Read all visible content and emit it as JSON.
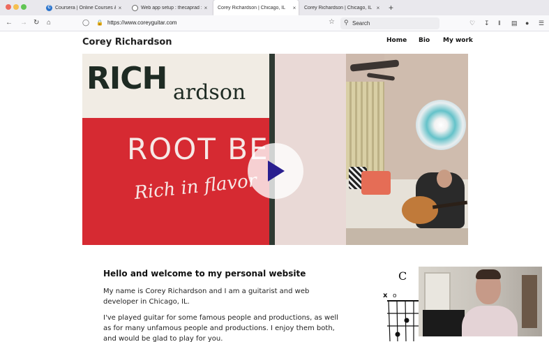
{
  "browser": {
    "tabs": [
      {
        "title": "Coursera | Online Courses & Cre",
        "icon": "coursera-favicon",
        "active": false
      },
      {
        "title": "Web app setup : thecaprad : Py",
        "icon": "reddit-favicon",
        "active": false
      },
      {
        "title": "Corey Richardson | Chicago, IL",
        "icon": "none",
        "active": true
      },
      {
        "title": "Corey Richardson | Chicago, IL",
        "icon": "none",
        "active": false
      }
    ],
    "close_glyph": "×",
    "new_tab_glyph": "+",
    "url": "https://www.coreyguitar.com",
    "search_placeholder": "Search",
    "colors": {
      "tabbar": "#e9e8ed",
      "navbar": "#f9f9fb",
      "accent_red": "#ed6a5e",
      "accent_yellow": "#f5bf4f",
      "accent_green": "#61c554"
    }
  },
  "site": {
    "title": "Corey Richardson",
    "nav": [
      "Home",
      "Bio",
      "My work"
    ],
    "hero": {
      "sign_text_1": "RICH",
      "sign_text_2": "ardson",
      "sign_text_3": "ROOT BEER",
      "sign_text_4": "Rich in flavor",
      "play_icon": "play-icon",
      "play_color": "#2a1f8f"
    },
    "heading": "Hello and welcome to my personal website",
    "paragraphs": [
      "My name is Corey Richardson and I am a guitarist and web developer in Chicago, IL.",
      "I've played guitar for some famous people and productions, as well as for many unfamous people and productions. I enjoy them both, and would be glad to play for you."
    ]
  }
}
